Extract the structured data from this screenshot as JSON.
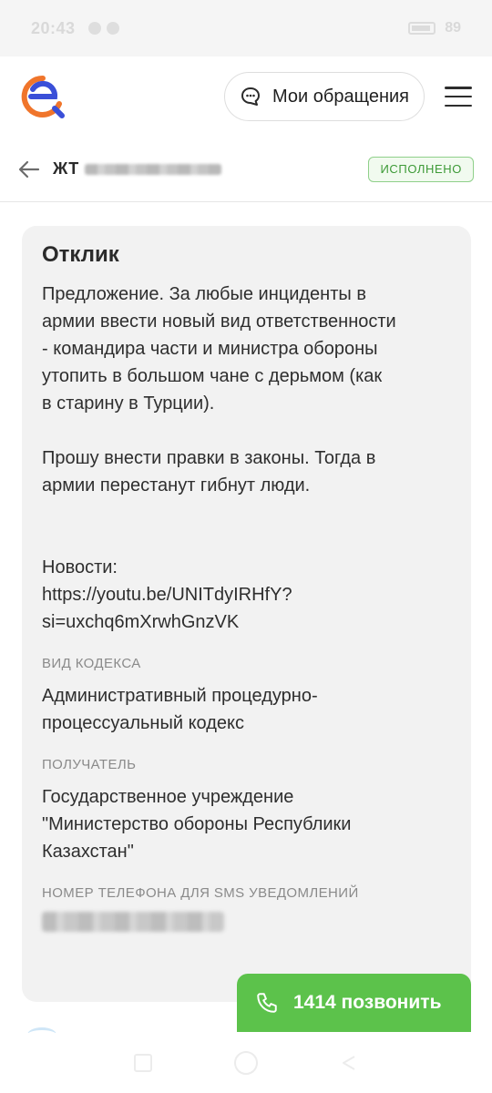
{
  "status_bar": {
    "time": "20:43",
    "battery": "89"
  },
  "header": {
    "appeals_label": "Мои обращения",
    "icons": {
      "logo": "e-logo-icon",
      "chat": "chat-bubble-icon",
      "menu": "hamburger-menu-icon"
    },
    "colors": {
      "logo_orange": "#f0752b",
      "logo_blue": "#3a4fd8"
    }
  },
  "detail": {
    "ticket_prefix": "ЖТ",
    "status": "ИСПОЛНЕНО",
    "status_color": "#3d9a37"
  },
  "card": {
    "title": "Отклик",
    "response_text": "Предложение. За любые инциденты в\nармии ввести новый вид ответственности\n- командира части и министра обороны\nутопить в большом чане с дерьмом (как\nв старину в Турции).\n\nПрошу внести правки в законы. Тогда в\nармии перестанут гибнут люди.\n\n\nНовости:\nhttps://youtu.be/UNITdyIRHfY?\nsi=uxchq6mXrwhGnzVK",
    "code_type_label": "ВИД КОДЕКСА",
    "code_type_value": "Административный процедурно-\nпроцессуальный кодекс",
    "recipient_label": "ПОЛУЧАТЕЛЬ",
    "recipient_value": "Государственное учреждение\n\"Министерство обороны Республики\nКазахстан\"",
    "phone_label": "НОМЕР ТЕЛЕФОНА ДЛЯ SMS УВЕДОМЛЕНИЙ"
  },
  "call_button": {
    "label": "1414 позвонить",
    "color": "#5cc24b",
    "icon": "phone-icon"
  }
}
